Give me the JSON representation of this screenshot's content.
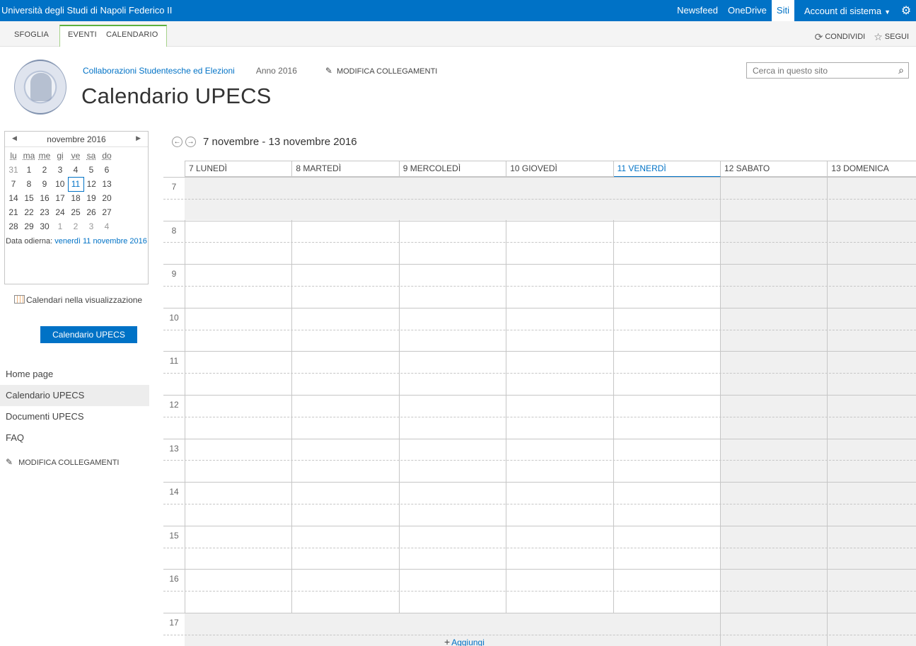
{
  "suitebar": {
    "brand": "Università degli Studi di Napoli Federico II",
    "links": [
      "Newsfeed",
      "OneDrive",
      "Siti"
    ],
    "active_link": "Siti",
    "account": "Account di sistema"
  },
  "ribbon": {
    "tabs": [
      "SFOGLIA",
      "EVENTI",
      "CALENDARIO"
    ],
    "share": "CONDIVIDI",
    "follow": "SEGUI"
  },
  "header": {
    "site": "Collaborazioni Studentesche ed Elezioni",
    "anno": "Anno 2016",
    "edit_links": "MODIFICA COLLEGAMENTI",
    "title": "Calendario UPECS",
    "search_placeholder": "Cerca in questo sito"
  },
  "minical": {
    "month": "novembre 2016",
    "weekdays": [
      "lu",
      "ma",
      "me",
      "gi",
      "ve",
      "sa",
      "do"
    ],
    "weeks": [
      [
        "31",
        "1",
        "2",
        "3",
        "4",
        "5",
        "6"
      ],
      [
        "7",
        "8",
        "9",
        "10",
        "11",
        "12",
        "13"
      ],
      [
        "14",
        "15",
        "16",
        "17",
        "18",
        "19",
        "20"
      ],
      [
        "21",
        "22",
        "23",
        "24",
        "25",
        "26",
        "27"
      ],
      [
        "28",
        "29",
        "30",
        "1",
        "2",
        "3",
        "4"
      ]
    ],
    "today_label": "Data odierna:",
    "today_link": "venerdì 11 novembre 2016"
  },
  "calendars_view": {
    "label": "Calendari nella visualizzazione",
    "button": "Calendario UPECS"
  },
  "leftnav": {
    "items": [
      "Home page",
      "Calendario UPECS",
      "Documenti UPECS",
      "FAQ"
    ],
    "selected": "Calendario UPECS",
    "edit_links": "MODIFICA COLLEGAMENTI"
  },
  "week": {
    "range": "7 novembre - 13 novembre 2016",
    "days": [
      "7 LUNEDÌ",
      "8 MARTEDÌ",
      "9 MERCOLEDÌ",
      "10 GIOVEDÌ",
      "11 VENERDÌ",
      "12 SABATO",
      "13 DOMENICA"
    ],
    "today_index": 4,
    "hours": [
      "7",
      "8",
      "9",
      "10",
      "11",
      "12",
      "13",
      "14",
      "15",
      "16",
      "17"
    ],
    "add_label": "Aggiungi"
  },
  "colors": {
    "accent": "#0072c6",
    "weekend": "#f0f0f0",
    "grid": "#c6c6c6"
  }
}
